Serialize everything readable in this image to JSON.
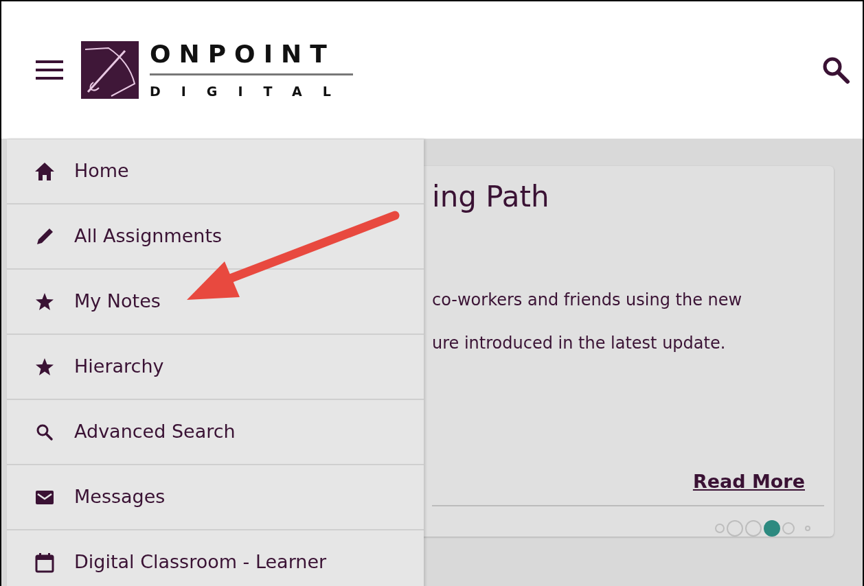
{
  "header": {
    "logo": {
      "line_1": "ONPOINT",
      "line_2": "DIGITAL"
    }
  },
  "menu": [
    {
      "label": "Home",
      "kind": "home"
    },
    {
      "label": "All Assignments",
      "kind": "assignments"
    },
    {
      "label": "My Notes",
      "kind": "starred"
    },
    {
      "label": "Hierarchy",
      "kind": "starred"
    },
    {
      "label": "Advanced Search",
      "kind": "search"
    },
    {
      "label": "Messages",
      "kind": "messages"
    },
    {
      "label": "Digital Classroom - Learner",
      "kind": "classroom"
    }
  ],
  "card": {
    "title": "ing Path",
    "text_lines": [
      "co-workers and friends using the new",
      "ure introduced in the latest update."
    ],
    "link": "Read More",
    "dots": [
      {
        "selected": false
      },
      {
        "selected": false
      },
      {
        "selected": false
      },
      {
        "selected": true
      },
      {
        "selected": false
      },
      {
        "selected": false
      }
    ]
  },
  "annotation": {
    "kind": "arrow"
  }
}
